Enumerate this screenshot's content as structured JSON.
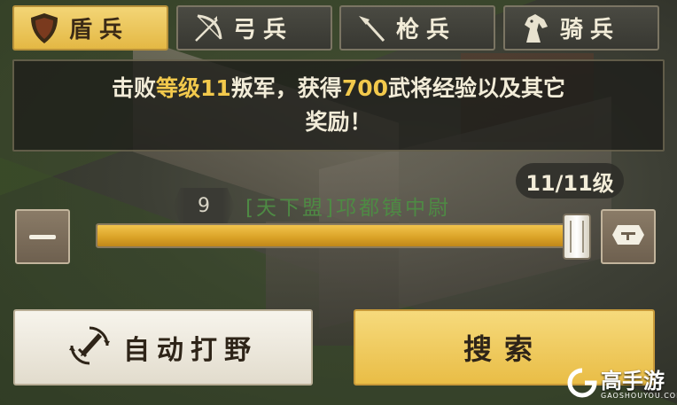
{
  "tabs": [
    {
      "label": "盾兵",
      "icon": "shield-icon",
      "active": true
    },
    {
      "label": "弓兵",
      "icon": "bow-icon",
      "active": false
    },
    {
      "label": "枪兵",
      "icon": "spear-icon",
      "active": false
    },
    {
      "label": "骑兵",
      "icon": "horse-icon",
      "active": false
    }
  ],
  "info": {
    "part1": "击败",
    "level_text": "等级11",
    "part2": "叛军，获得",
    "exp": "700",
    "part3": "武将经验以及其它",
    "line2": "奖励！"
  },
  "level": {
    "display": "11/11级",
    "progress": 1.0
  },
  "target": {
    "level": "9",
    "name": "[天下盟]邛都镇中尉"
  },
  "buttons": {
    "auto_label": "自动打野",
    "search_label": "搜索"
  },
  "watermark": {
    "name": "高手游",
    "url": "GAOSHOUYOU.COM"
  },
  "colors": {
    "accent": "#f2c94c",
    "active_tab": "#e9bd46",
    "target_name": "#4e8a44"
  }
}
